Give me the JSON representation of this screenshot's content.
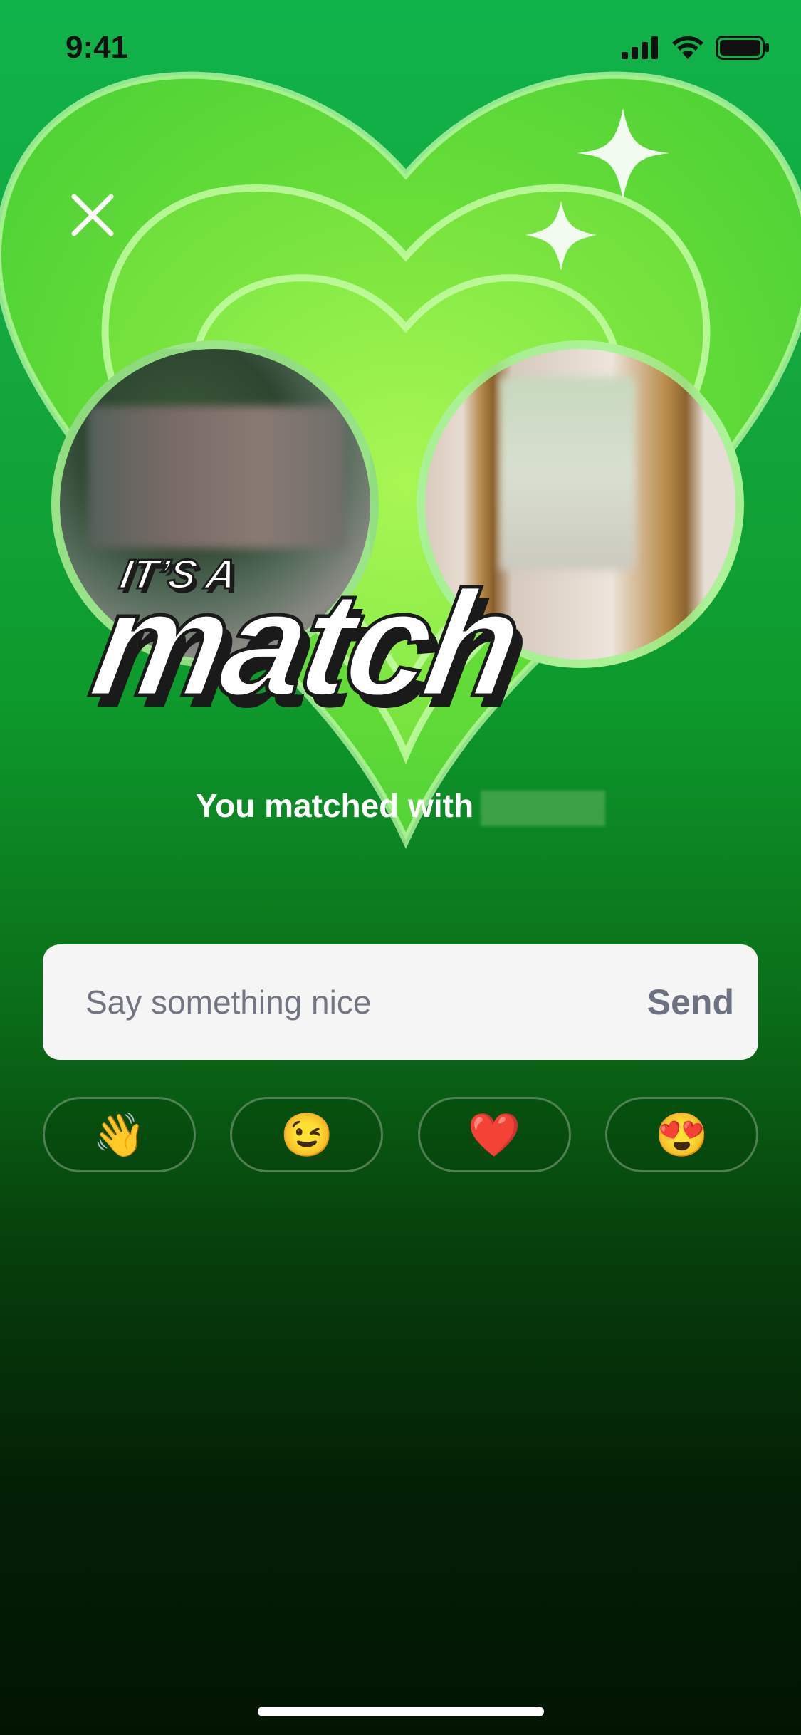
{
  "status_bar": {
    "time": "9:41",
    "icons": [
      "cellular-signal-icon",
      "wifi-icon",
      "battery-icon"
    ]
  },
  "header": {
    "close_icon": "close-icon",
    "sparkle_icons": [
      "sparkle-icon",
      "sparkle-icon"
    ]
  },
  "title": {
    "line1": "IT’S A",
    "line2": "match"
  },
  "matched": {
    "text": "You matched with"
  },
  "message": {
    "placeholder": "Say something nice",
    "send_label": "Send"
  },
  "emoji_reactions": [
    {
      "emoji": "👋",
      "name": "waving-hand"
    },
    {
      "emoji": "😉",
      "name": "winking-face"
    },
    {
      "emoji": "❤️",
      "name": "red-heart"
    },
    {
      "emoji": "😍",
      "name": "heart-eyes"
    }
  ],
  "colors": {
    "brand_green": "#14b33f",
    "heart_light": "#9cf04c",
    "send_text": "#6c7282"
  }
}
